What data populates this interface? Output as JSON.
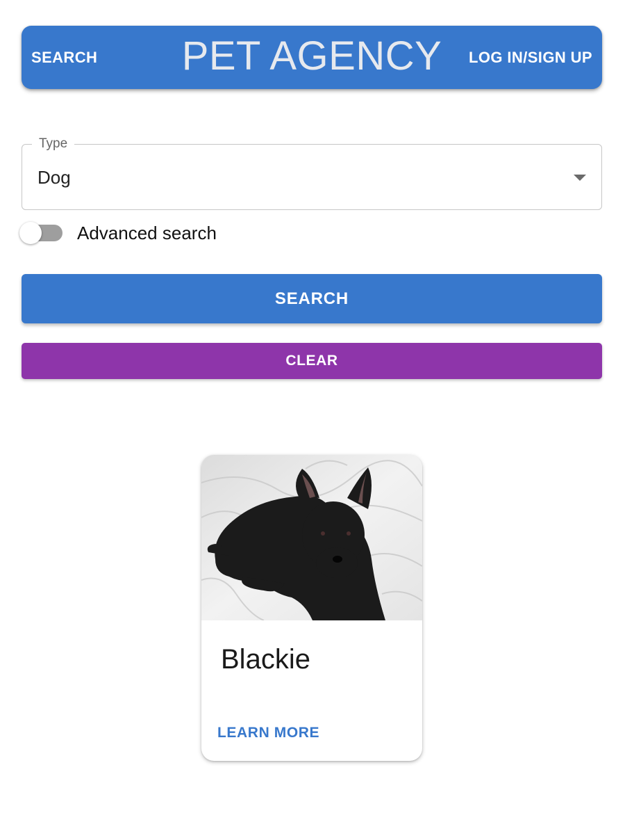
{
  "header": {
    "search_link": "SEARCH",
    "title": "PET AGENCY",
    "login_link": "LOG IN/SIGN UP"
  },
  "filters": {
    "type_label": "Type",
    "type_value": "Dog",
    "advanced_search_label": "Advanced search",
    "advanced_search_on": false
  },
  "actions": {
    "search_label": "SEARCH",
    "clear_label": "CLEAR"
  },
  "results": [
    {
      "name": "Blackie",
      "photo_icon": "black-scottish-terrier-photo",
      "learn_more_label": "LEARN MORE"
    }
  ],
  "colors": {
    "primary": "#3878cc",
    "clear_button": "#8e35aa",
    "title_text": "#e6e9ee",
    "switch_track": "#9e9e9e"
  }
}
